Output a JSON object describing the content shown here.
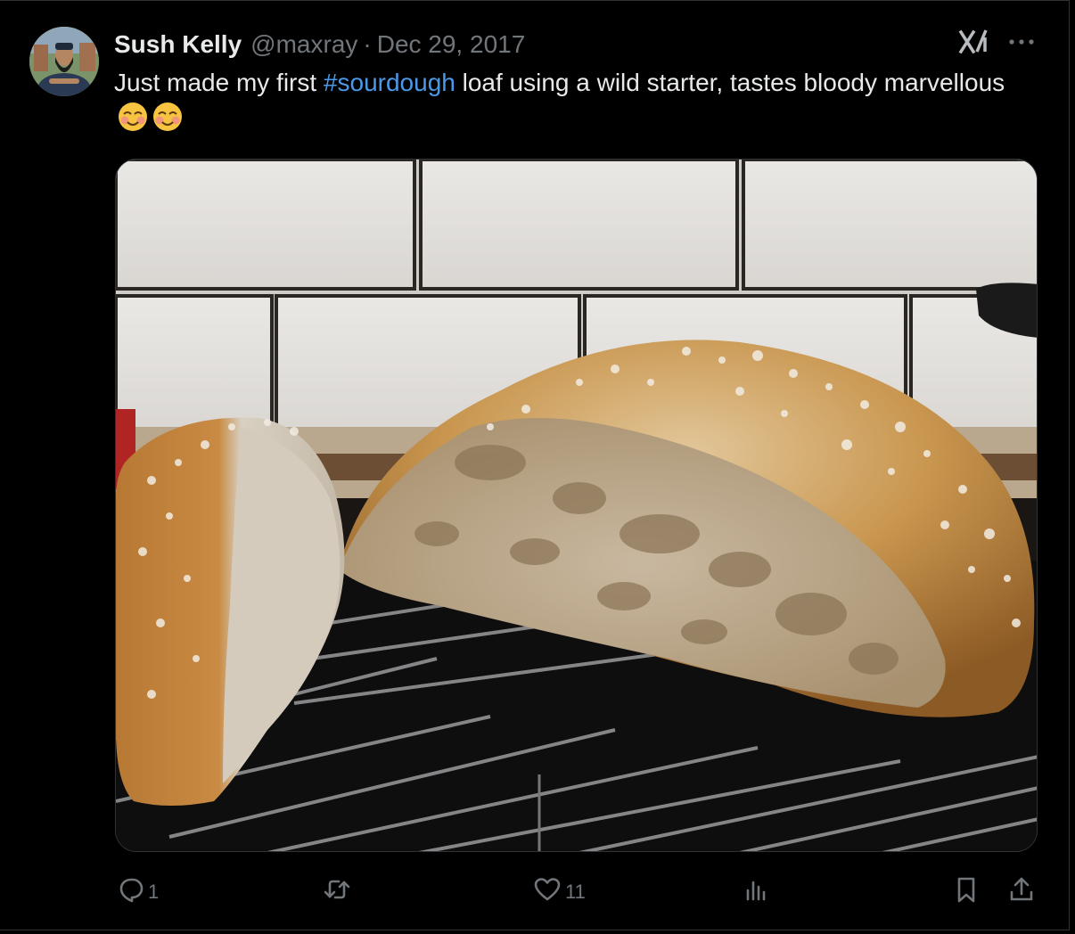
{
  "tweet": {
    "author_name": "Sush Kelly",
    "handle": "@maxray",
    "separator": "·",
    "date": "Dec 29, 2017",
    "text_before": "Just made my first ",
    "hashtag": "#sourdough",
    "text_after": " loaf using a wild starter, tastes bloody marvellous ",
    "emojis": [
      "smiling-face-with-smiling-eyes",
      "smiling-face-with-smiling-eyes"
    ],
    "media_description_icon": "bread-photo"
  },
  "actions": {
    "reply_count": "1",
    "retweet_count": "",
    "like_count": "11",
    "views_count": ""
  },
  "colors": {
    "background": "#000000",
    "text": "#e7e9ea",
    "muted": "#71767b",
    "link": "#4a99e9",
    "border": "#2f3336"
  }
}
